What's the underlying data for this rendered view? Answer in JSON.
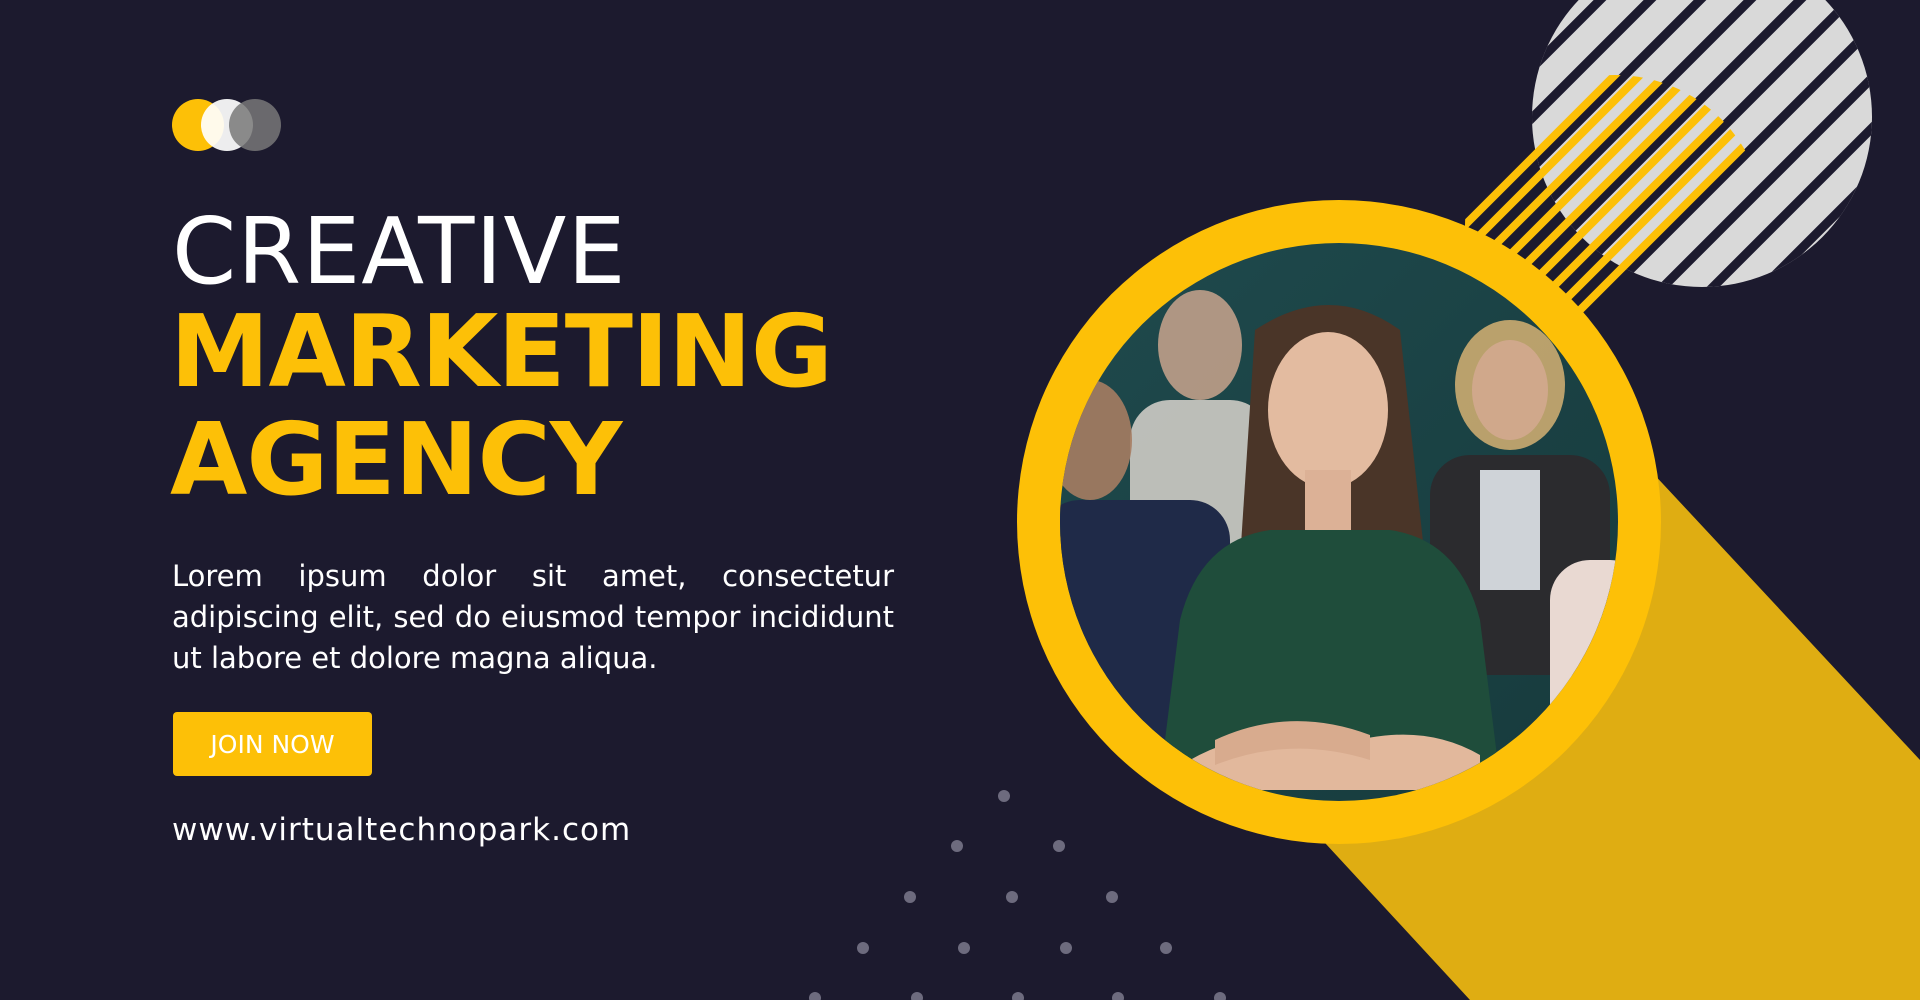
{
  "headline": {
    "line1": "CREATIVE",
    "line2": "MARKETING",
    "line3": "AGENCY"
  },
  "description": "Lorem ipsum dolor sit amet, consectetur adipiscing elit, sed do eiusmod tempor incididunt ut labore et dolore magna aliqua.",
  "cta": {
    "label": "JOIN NOW"
  },
  "website": "www.virtualtechnopark.com",
  "colors": {
    "background": "#1c1a2e",
    "accent": "#fdc007",
    "accent_dark": "#dfad12",
    "text": "#ffffff",
    "circle_grey": "#d9d9d9",
    "dots": "#6d6b7e"
  },
  "icons": {
    "logo": "three-overlapping-circles-logo",
    "photo": "team-photo-woman-arms-crossed"
  }
}
